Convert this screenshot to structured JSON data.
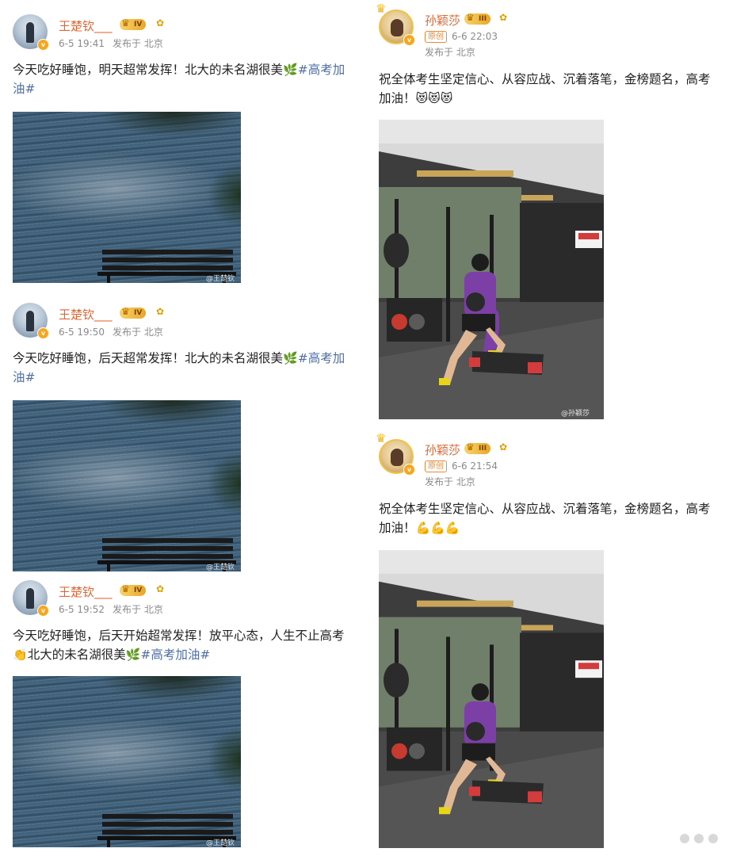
{
  "left": {
    "posts": [
      {
        "username": "王楚钦___",
        "level": "IV",
        "time": "6-5 19:41",
        "location": "发布于 北京",
        "text_plain": "今天吃好睡饱，明天超常发挥！北大的未名湖很美",
        "emoji_1": "🌿",
        "text_tail": "",
        "topic": "#高考加油#",
        "photo_watermark": "@王楚钦"
      },
      {
        "username": "王楚钦___",
        "level": "IV",
        "time": "6-5 19:50",
        "location": "发布于 北京",
        "text_plain": "今天吃好睡饱，后天超常发挥！北大的未名湖很美",
        "emoji_1": "🌿",
        "text_tail": "",
        "topic": "#高考加油#",
        "photo_watermark": "@王楚钦"
      },
      {
        "username": "王楚钦___",
        "level": "IV",
        "time": "6-5 19:52",
        "location": "发布于 北京",
        "text_plain": "今天吃好睡饱，后天开始超常发挥！放平心态，人生不止高考",
        "emoji_1": "👏",
        "text_tail": "北大的未名湖很美",
        "emoji_2": "🌿",
        "topic": "#高考加油#",
        "photo_watermark": "@王楚钦"
      }
    ]
  },
  "right": {
    "posts": [
      {
        "username": "孙颖莎",
        "level": "III",
        "original_tag": "原创",
        "time": "6-6 22:03",
        "location": "发布于 北京",
        "text_plain": "祝全体考生坚定信心、从容应战、沉着落笔，金榜题名，高考加油！",
        "emojis": "😻😻😻",
        "photo_watermark": "@孙颖莎"
      },
      {
        "username": "孙颖莎",
        "level": "III",
        "original_tag": "原创",
        "time": "6-6 21:54",
        "location": "发布于 北京",
        "text_plain": "祝全体考生坚定信心、从容应战、沉着落笔，金榜题名，高考加油！",
        "emojis": "💪💪💪",
        "photo_watermark": ""
      }
    ]
  },
  "colors": {
    "username": "#e8632e",
    "topic": "#4f6ea6",
    "meta": "#8a8a8a",
    "verified_badge": "#f5a623"
  }
}
